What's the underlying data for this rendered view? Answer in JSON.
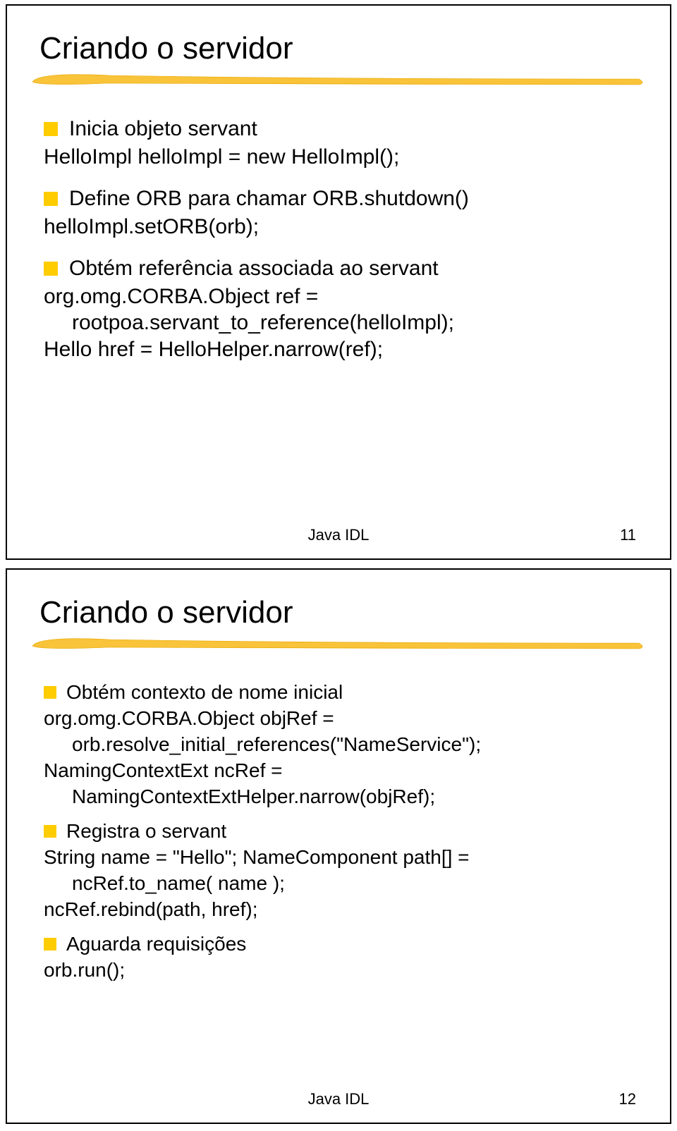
{
  "slide1": {
    "title": "Criando o servidor",
    "b1": "Inicia objeto servant",
    "c1": "HelloImpl helloImpl = new HelloImpl();",
    "b2": "Define ORB para chamar ORB.shutdown()",
    "c2": "helloImpl.setORB(orb);",
    "b3": "Obtém referência associada ao servant",
    "c3a": "org.omg.CORBA.Object ref =",
    "c3b": "rootpoa.servant_to_reference(helloImpl);",
    "c3c": "Hello href = HelloHelper.narrow(ref);",
    "footer": "Java IDL",
    "page": "11"
  },
  "slide2": {
    "title": "Criando o servidor",
    "b1": "Obtém contexto de nome inicial",
    "c1a": "org.omg.CORBA.Object objRef =",
    "c1b": "orb.resolve_initial_references(\"NameService\");",
    "c1c": "NamingContextExt ncRef =",
    "c1d": "NamingContextExtHelper.narrow(objRef);",
    "b2": "Registra o servant",
    "c2a": "String name = \"Hello\"; NameComponent path[] =",
    "c2b": "ncRef.to_name( name );",
    "c2c": "ncRef.rebind(path, href);",
    "b3": "Aguarda requisições",
    "c3": "orb.run();",
    "footer": "Java IDL",
    "page": "12"
  }
}
